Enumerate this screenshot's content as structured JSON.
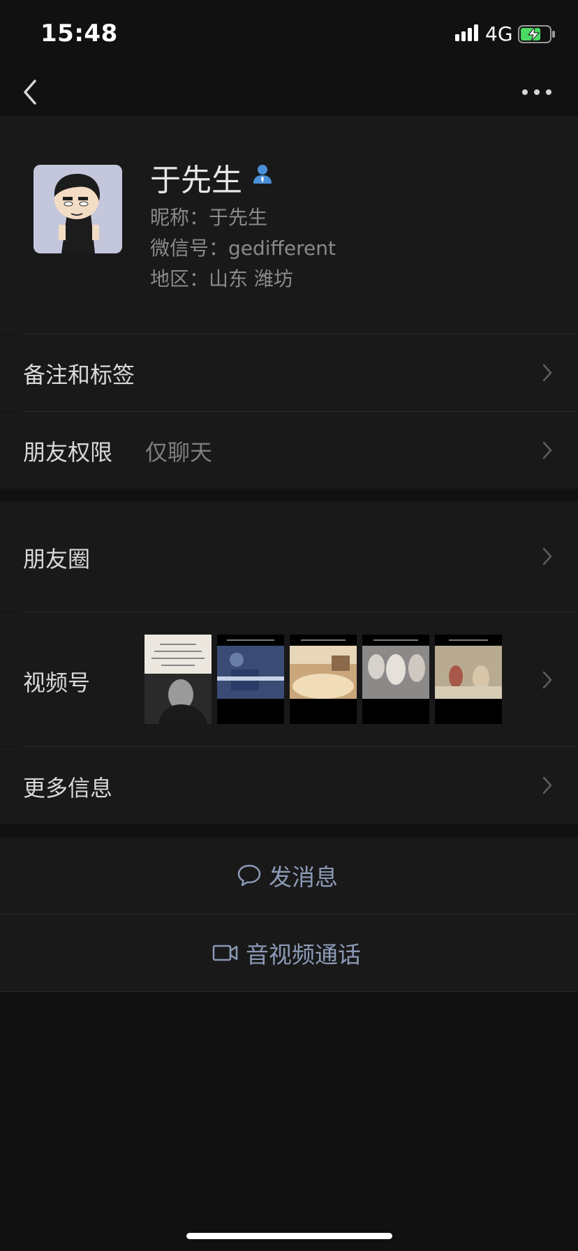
{
  "status": {
    "time": "15:48",
    "network": "4G"
  },
  "profile": {
    "name": "于先生",
    "nickname": "昵称：于先生",
    "wechat_id": "微信号：gedifferent",
    "region": "地区：山东 潍坊"
  },
  "rows": {
    "remarks": {
      "label": "备注和标签"
    },
    "permissions": {
      "label": "朋友权限",
      "value": "仅聊天"
    },
    "moments": {
      "label": "朋友圈"
    },
    "channels": {
      "label": "视频号"
    },
    "more_info": {
      "label": "更多信息"
    }
  },
  "actions": {
    "message": "发消息",
    "call": "音视频通话"
  },
  "icons": [
    "back-icon",
    "more-icon",
    "verified-user-icon",
    "chevron-right-icon",
    "chat-bubble-icon",
    "video-camera-icon",
    "signal-icon",
    "battery-charging-icon"
  ],
  "colors": {
    "background": "#111111",
    "card": "#191919",
    "accent_text": "#8c9ab6",
    "battery": "#4cd964",
    "verified": "#4a90d9"
  }
}
